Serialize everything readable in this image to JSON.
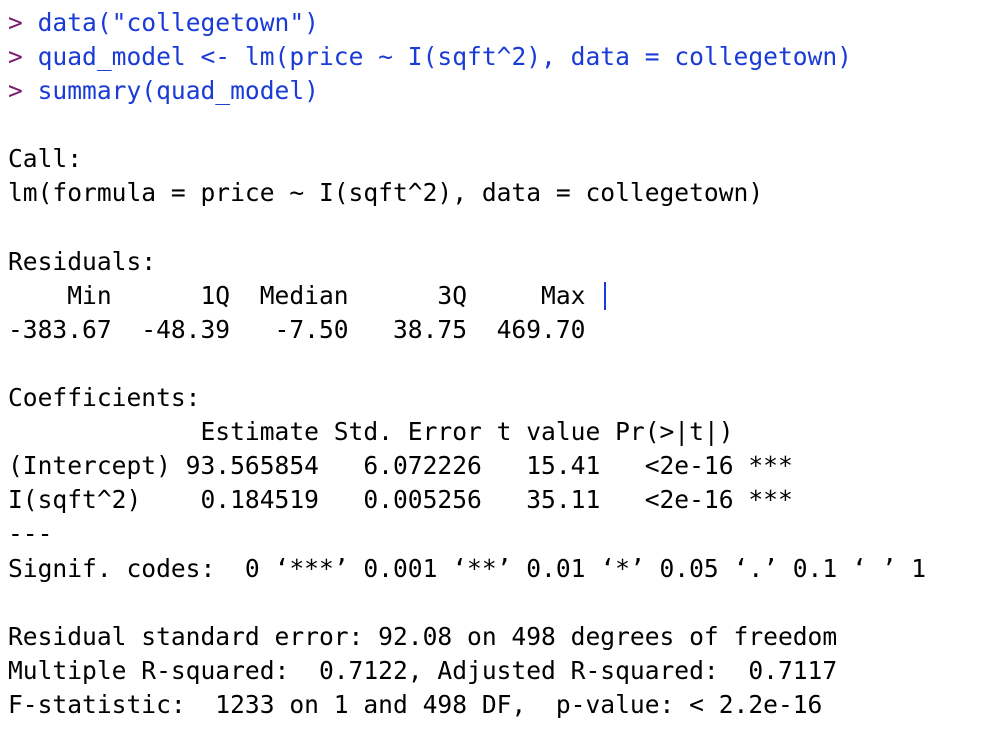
{
  "commands": [
    {
      "prompt": ">",
      "code": "data(\"collegetown\")"
    },
    {
      "prompt": ">",
      "code": "quad_model <- lm(price ~ I(sqft^2), data = collegetown)"
    },
    {
      "prompt": ">",
      "code": "summary(quad_model)"
    }
  ],
  "call": {
    "heading": "Call:",
    "formula": "lm(formula = price ~ I(sqft^2), data = collegetown)"
  },
  "residuals": {
    "heading": "Residuals:",
    "header_row": "    Min      1Q  Median      3Q     Max ",
    "value_row": "-383.67  -48.39   -7.50   38.75  469.70"
  },
  "coefficients": {
    "heading": "Coefficients:",
    "header_row": "             Estimate Std. Error t value Pr(>|t|)    ",
    "rows": [
      "(Intercept) 93.565854   6.072226   15.41   <2e-16 ***",
      "I(sqft^2)    0.184519   0.005256   35.11   <2e-16 ***"
    ],
    "separator": "---",
    "signif_codes": "Signif. codes:  0 ‘***’ 0.001 ‘**’ 0.01 ‘*’ 0.05 ‘.’ 0.1 ‘ ’ 1"
  },
  "fit_stats": [
    "Residual standard error: 92.08 on 498 degrees of freedom",
    "Multiple R-squared:  0.7122, Adjusted R-squared:  0.7117",
    "F-statistic:  1233 on 1 and 498 DF,  p-value: < 2.2e-16"
  ],
  "colors": {
    "prompt": "#7a1d6e",
    "command": "#1a3bd6",
    "output": "#000000",
    "cursor": "#1a3bd6"
  }
}
